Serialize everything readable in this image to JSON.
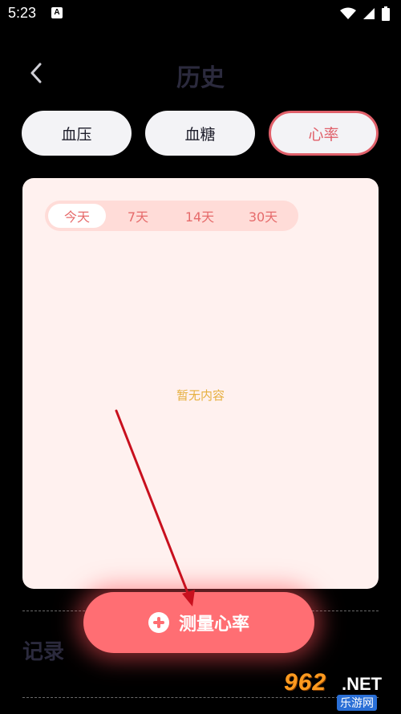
{
  "status_bar": {
    "time": "5:23",
    "a_badge": "A"
  },
  "header": {
    "title": "历史"
  },
  "tabs": [
    {
      "label": "血压"
    },
    {
      "label": "血糖"
    },
    {
      "label": "心率"
    }
  ],
  "card": {
    "ranges": [
      {
        "label": "今天"
      },
      {
        "label": "7天"
      },
      {
        "label": "14天"
      },
      {
        "label": "30天"
      }
    ],
    "selected_range": "今天",
    "empty_text": "暂无内容"
  },
  "records": {
    "title": "记录"
  },
  "measure_button": {
    "label": "测量心率"
  },
  "watermark": {
    "logo": "962",
    "net": ".NET",
    "site": "乐游网"
  },
  "colors": {
    "accent": "#ff6e73",
    "tab_active_border": "#e0606a",
    "card_bg": "#fff1ef",
    "empty_text": "#e6b040",
    "annotation_arrow": "#c8101e"
  }
}
